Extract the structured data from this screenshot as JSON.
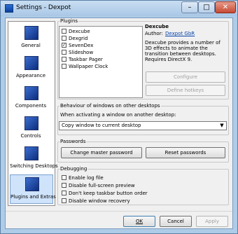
{
  "window": {
    "title": "Settings - Dexpot"
  },
  "titlebar_buttons": {
    "minimize": "–",
    "maximize": "□",
    "close": "✕"
  },
  "nav": {
    "items": [
      {
        "label": "General",
        "icon": "general-icon",
        "selected": false
      },
      {
        "label": "Appearance",
        "icon": "appearance-icon",
        "selected": false
      },
      {
        "label": "Components",
        "icon": "components-icon",
        "selected": false
      },
      {
        "label": "Controls",
        "icon": "controls-icon",
        "selected": false
      },
      {
        "label": "Switching Desktops",
        "icon": "switching-desktops-icon",
        "selected": false
      },
      {
        "label": "Plugins and Extras",
        "icon": "plugins-extras-icon",
        "selected": true
      }
    ]
  },
  "plugins": {
    "group_label": "Plugins",
    "items": [
      {
        "label": "Dexcube",
        "checked": false
      },
      {
        "label": "Dexgrid",
        "checked": false
      },
      {
        "label": "SevenDex",
        "checked": true
      },
      {
        "label": "Slideshow",
        "checked": false
      },
      {
        "label": "Taskbar Pager",
        "checked": false
      },
      {
        "label": "Wallpaper Clock",
        "checked": false
      }
    ],
    "detail": {
      "name": "Dexcube",
      "author_label": "Author:",
      "author_value": "Dexpot GbR",
      "description": "Dexcube provides a number of 3D effects to animate the transition between desktops. Requires DirectX 9."
    },
    "configure_label": "Configure",
    "define_hotkeys_label": "Define hotkeys"
  },
  "behaviour": {
    "group_label": "Behaviour of windows on other desktops",
    "prompt": "When activating a window on another desktop:",
    "selected_option": "Copy window to current desktop"
  },
  "passwords": {
    "group_label": "Passwords",
    "change_label": "Change master password",
    "reset_label": "Reset passwords"
  },
  "debugging": {
    "group_label": "Debugging",
    "options": [
      {
        "label": "Enable log file",
        "checked": false
      },
      {
        "label": "Disable full-screen preview",
        "checked": false
      },
      {
        "label": "Don't keep taskbar button order",
        "checked": false
      },
      {
        "label": "Disable window recovery",
        "checked": false
      }
    ]
  },
  "footer": {
    "ok_label": "OK",
    "cancel_label": "Cancel",
    "apply_label": "Apply"
  }
}
